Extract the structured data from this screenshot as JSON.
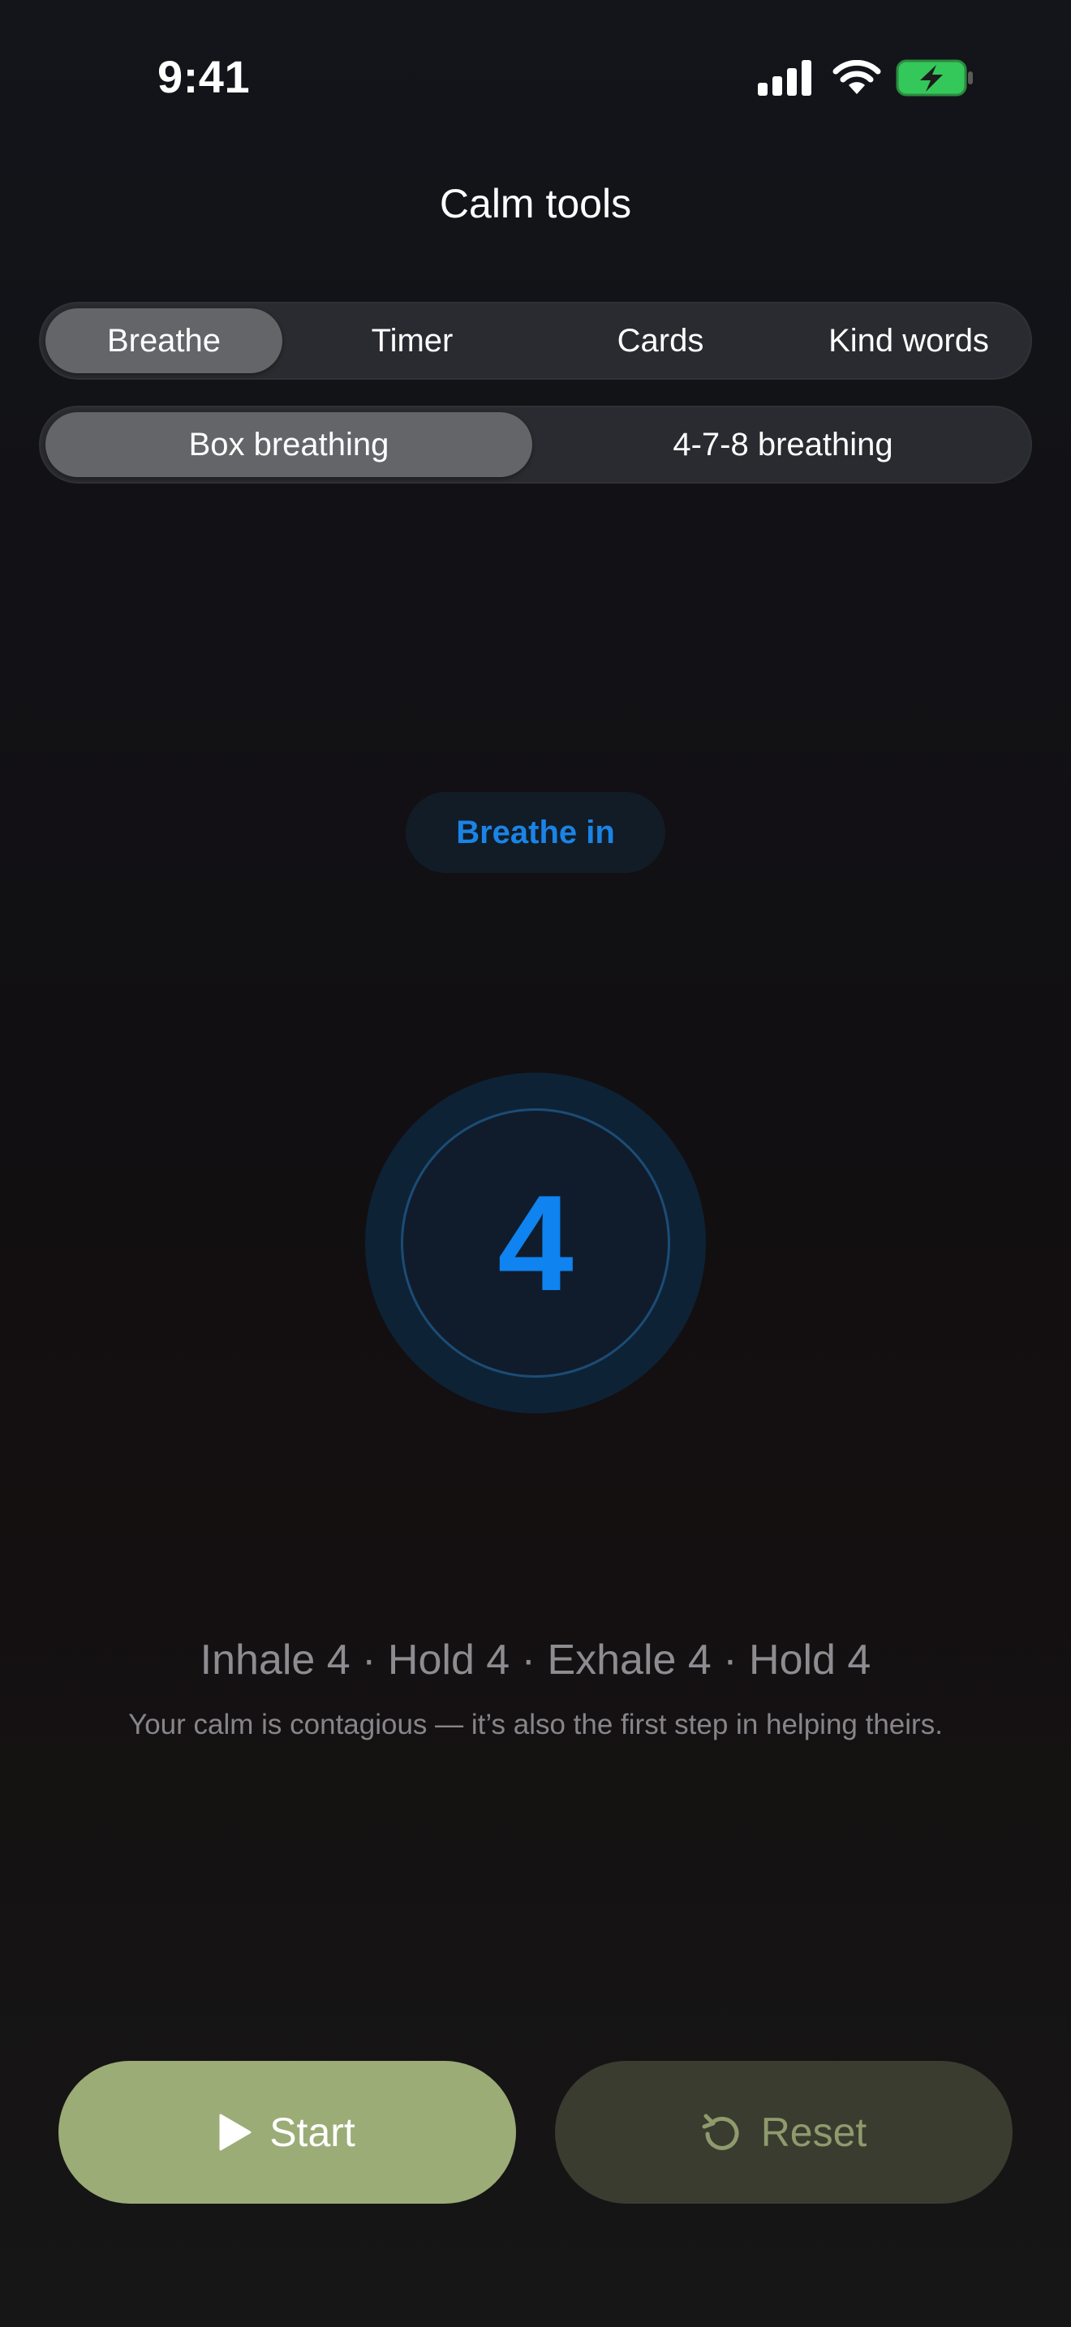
{
  "status_bar": {
    "time": "9:41",
    "icons": [
      "signal-icon",
      "wifi-icon",
      "battery-charging-icon"
    ]
  },
  "header": {
    "title": "Calm tools"
  },
  "tabs": [
    {
      "label": "Breathe",
      "active": true
    },
    {
      "label": "Timer",
      "active": false
    },
    {
      "label": "Cards",
      "active": false
    },
    {
      "label": "Kind words",
      "active": false
    }
  ],
  "modes": [
    {
      "label": "Box breathing",
      "active": true
    },
    {
      "label": "4-7-8 breathing",
      "active": false
    }
  ],
  "exercise": {
    "phase": "Breathe in",
    "count": "4",
    "pattern": "Inhale 4 · Hold 4 · Exhale 4 · Hold 4",
    "message": "Your calm is contagious — it’s also the first step in helping theirs."
  },
  "controls": {
    "start_label": "Start",
    "start_icon": "play-icon",
    "reset_label": "Reset",
    "reset_icon": "reset-icon"
  },
  "colors": {
    "accent_blue": "#0f83ef",
    "start_green": "#9bac77",
    "reset_bg": "#3a3c2f",
    "battery_green": "#34c759"
  }
}
